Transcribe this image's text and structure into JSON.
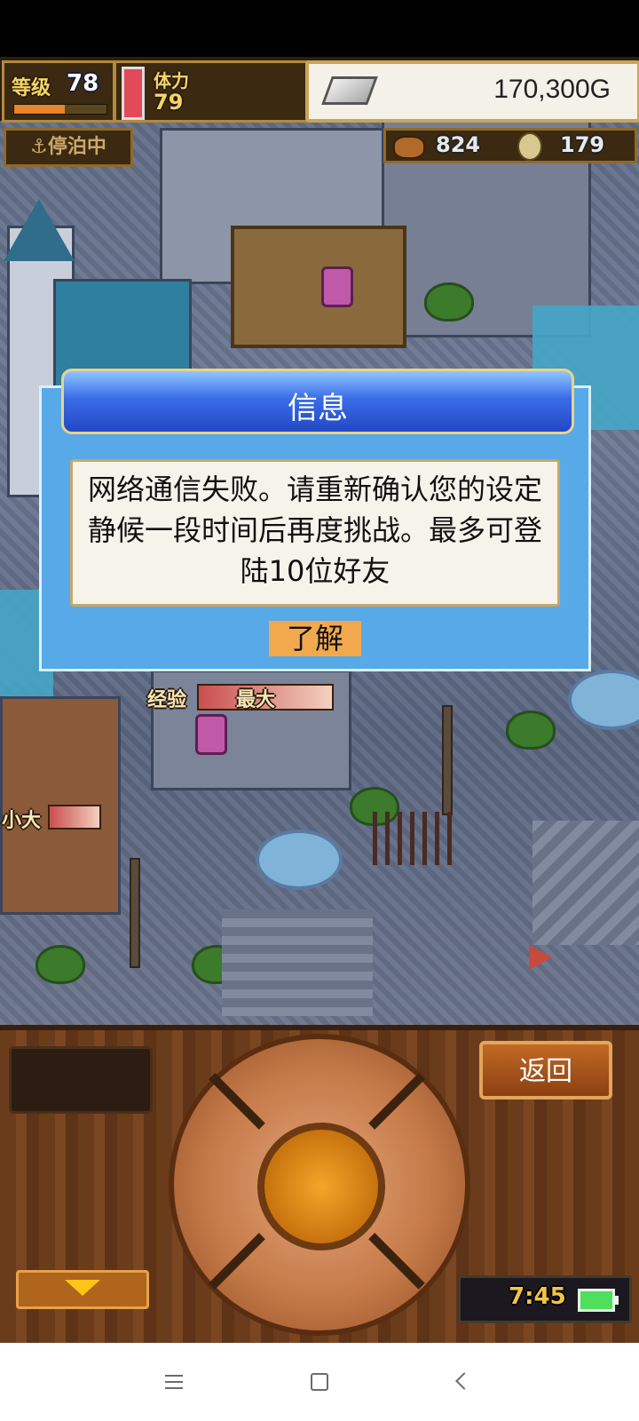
{
  "hud": {
    "level_label": "等级",
    "level_value": "78",
    "level_progress": 0.55,
    "stamina_label": "体力",
    "stamina_value": "79",
    "gold": "170,300G"
  },
  "status": {
    "docked_label": "⚓停泊中",
    "resource_a": "824",
    "resource_b": "179"
  },
  "scene": {
    "exp_label": "经验",
    "exp_value": "最大",
    "side_label": "小大"
  },
  "dialog": {
    "title": "信息",
    "message": "网络通信失败。请重新确认您的设定静候一段时间后再度挑战。最多可登陆10位好友",
    "ok_label": "了解"
  },
  "controls": {
    "back_label": "返回",
    "clock": "7:45"
  },
  "navbar": {
    "menu_icon": "menu-icon",
    "home_icon": "home-icon",
    "back_icon": "back-icon"
  },
  "colors": {
    "dialog_bg": "#58a9e8",
    "dialog_header": "#2348c4",
    "ok_button": "#f2a94e",
    "panel_wood": "#6b3c1c"
  }
}
